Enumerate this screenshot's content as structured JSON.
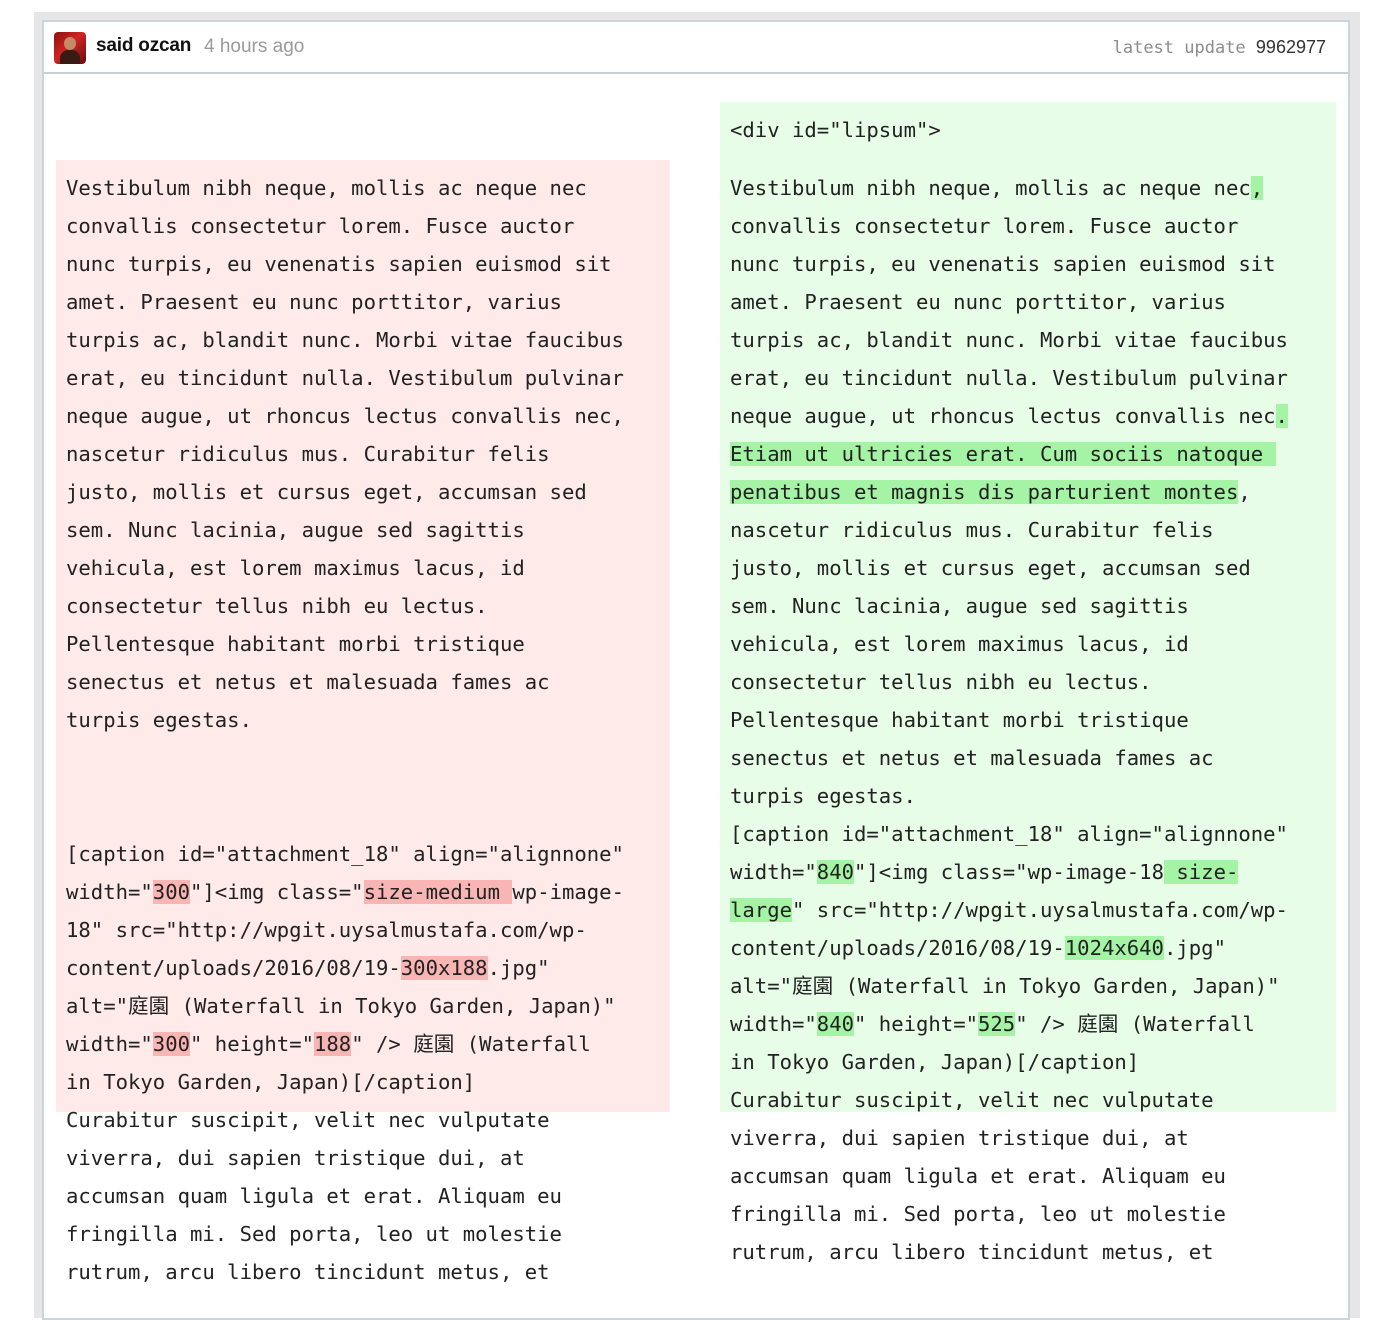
{
  "header": {
    "author": "said ozcan",
    "time_ago": "4 hours ago",
    "update_label": "latest update",
    "update_hash": "9962977"
  },
  "icons": {
    "avatar": "user-avatar"
  },
  "colors": {
    "deleted_block": "#feeae9",
    "deleted_word": "#f8b5b4",
    "inserted_block": "#e8fde8",
    "inserted_word": "#a5f3a5"
  },
  "left": {
    "lines": [
      [
        [
          "Vestibulum nibh neque, mollis ac neque nec",
          null
        ]
      ],
      [
        [
          "convallis consectetur lorem. Fusce auctor",
          null
        ]
      ],
      [
        [
          "nunc turpis, eu venenatis sapien euismod sit",
          null
        ]
      ],
      [
        [
          "amet. Praesent eu nunc porttitor, varius",
          null
        ]
      ],
      [
        [
          "turpis ac, blandit nunc. Morbi vitae faucibus",
          null
        ]
      ],
      [
        [
          "erat, eu tincidunt nulla. Vestibulum pulvinar",
          null
        ]
      ],
      [
        [
          "neque augue, ut rhoncus lectus convallis nec,",
          null
        ]
      ],
      [
        [
          "nascetur ridiculus mus. Curabitur felis",
          null
        ]
      ],
      [
        [
          "justo, mollis et cursus eget, accumsan sed",
          null
        ]
      ],
      [
        [
          "sem. Nunc lacinia, augue sed sagittis",
          null
        ]
      ],
      [
        [
          "vehicula, est lorem maximus lacus, id",
          null
        ]
      ],
      [
        [
          "consectetur tellus nibh eu lectus.",
          null
        ]
      ],
      [
        [
          "Pellentesque habitant morbi tristique",
          null
        ]
      ],
      [
        [
          "senectus et netus et malesuada fames ac",
          null
        ]
      ],
      [
        [
          "turpis egestas.",
          null
        ]
      ],
      [
        [
          "",
          null
        ]
      ],
      [
        [
          "",
          null
        ]
      ],
      [
        [
          "[caption id=\"attachment_18\" align=\"alignnone\"",
          null
        ]
      ],
      [
        [
          "width=\"",
          null
        ],
        [
          "300",
          "del"
        ],
        [
          "\"]<img class=\"",
          null
        ],
        [
          "size-medium ",
          "del"
        ],
        [
          "wp-image-",
          null
        ]
      ],
      [
        [
          "18\" src=\"http://wpgit.uysalmustafa.com/wp-",
          null
        ]
      ],
      [
        [
          "content/uploads/2016/08/19-",
          null
        ],
        [
          "300x188",
          "del"
        ],
        [
          ".jpg\"",
          null
        ]
      ],
      [
        [
          "alt=\"庭園 (Waterfall in Tokyo Garden, Japan)\"",
          null
        ]
      ],
      [
        [
          "width=\"",
          null
        ],
        [
          "300",
          "del"
        ],
        [
          "\" height=\"",
          null
        ],
        [
          "188",
          "del"
        ],
        [
          "\" /> 庭園 (Waterfall",
          null
        ]
      ],
      [
        [
          "in Tokyo Garden, Japan)[/caption]",
          null
        ]
      ],
      [
        [
          "Curabitur suscipit, velit nec vulputate",
          null
        ]
      ],
      [
        [
          "viverra, dui sapien tristique dui, at",
          null
        ]
      ],
      [
        [
          "accumsan quam ligula et erat. Aliquam eu",
          null
        ]
      ],
      [
        [
          "fringilla mi. Sed porta, leo ut molestie",
          null
        ]
      ],
      [
        [
          "rutrum, arcu libero tincidunt metus, et",
          null
        ]
      ]
    ]
  },
  "right": {
    "lines": [
      [
        [
          "<div id=\"lipsum\">",
          null
        ]
      ],
      [
        [
          "Vestibulum nibh neque, mollis ac neque nec",
          null
        ],
        [
          ",",
          "ins"
        ]
      ],
      [
        [
          "convallis consectetur lorem. Fusce auctor",
          null
        ]
      ],
      [
        [
          "nunc turpis, eu venenatis sapien euismod sit",
          null
        ]
      ],
      [
        [
          "amet. Praesent eu nunc porttitor, varius",
          null
        ]
      ],
      [
        [
          "turpis ac, blandit nunc. Morbi vitae faucibus",
          null
        ]
      ],
      [
        [
          "erat, eu tincidunt nulla. Vestibulum pulvinar",
          null
        ]
      ],
      [
        [
          "neque augue, ut rhoncus lectus convallis nec",
          null
        ],
        [
          ".",
          "ins"
        ]
      ],
      [
        [
          "Etiam ut ultricies erat. Cum sociis natoque ",
          "ins"
        ]
      ],
      [
        [
          "penatibus et magnis dis parturient montes",
          "ins"
        ],
        [
          ",",
          null
        ]
      ],
      [
        [
          "nascetur ridiculus mus. Curabitur felis",
          null
        ]
      ],
      [
        [
          "justo, mollis et cursus eget, accumsan sed",
          null
        ]
      ],
      [
        [
          "sem. Nunc lacinia, augue sed sagittis",
          null
        ]
      ],
      [
        [
          "vehicula, est lorem maximus lacus, id",
          null
        ]
      ],
      [
        [
          "consectetur tellus nibh eu lectus.",
          null
        ]
      ],
      [
        [
          "Pellentesque habitant morbi tristique",
          null
        ]
      ],
      [
        [
          "senectus et netus et malesuada fames ac",
          null
        ]
      ],
      [
        [
          "turpis egestas.",
          null
        ]
      ],
      [
        [
          "[caption id=\"attachment_18\" align=\"alignnone\"",
          null
        ]
      ],
      [
        [
          "width=\"",
          null
        ],
        [
          "840",
          "ins"
        ],
        [
          "\"]<img class=\"wp-image-18",
          null
        ],
        [
          " size-",
          "ins"
        ]
      ],
      [
        [
          "large",
          "ins"
        ],
        [
          "\" src=\"http://wpgit.uysalmustafa.com/wp-",
          null
        ]
      ],
      [
        [
          "content/uploads/2016/08/19-",
          null
        ],
        [
          "1024x640",
          "ins"
        ],
        [
          ".jpg\"",
          null
        ]
      ],
      [
        [
          "alt=\"庭園 (Waterfall in Tokyo Garden, Japan)\"",
          null
        ]
      ],
      [
        [
          "width=\"",
          null
        ],
        [
          "840",
          "ins"
        ],
        [
          "\" height=\"",
          null
        ],
        [
          "525",
          "ins"
        ],
        [
          "\" /> 庭園 (Waterfall",
          null
        ]
      ],
      [
        [
          "in Tokyo Garden, Japan)[/caption]",
          null
        ]
      ],
      [
        [
          "Curabitur suscipit, velit nec vulputate",
          null
        ]
      ],
      [
        [
          "viverra, dui sapien tristique dui, at",
          null
        ]
      ],
      [
        [
          "accumsan quam ligula et erat. Aliquam eu",
          null
        ]
      ],
      [
        [
          "fringilla mi. Sed porta, leo ut molestie",
          null
        ]
      ],
      [
        [
          "rutrum, arcu libero tincidunt metus, et",
          null
        ]
      ]
    ]
  }
}
